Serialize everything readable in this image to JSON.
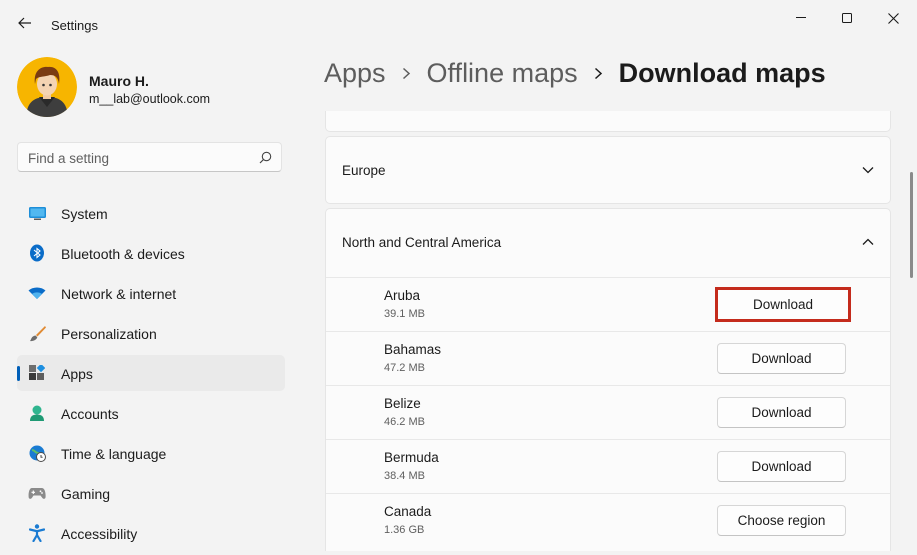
{
  "window": {
    "title": "Settings",
    "back_icon": "back-arrow-icon",
    "controls": [
      "minimize-icon",
      "maximize-icon",
      "close-icon"
    ]
  },
  "profile": {
    "name": "Mauro H.",
    "email": "m__lab@outlook.com"
  },
  "search": {
    "placeholder": "Find a setting",
    "icon": "search-icon"
  },
  "sidebar": {
    "items": [
      {
        "label": "System",
        "icon": "system-icon",
        "active": false
      },
      {
        "label": "Bluetooth & devices",
        "icon": "bluetooth-icon",
        "active": false
      },
      {
        "label": "Network & internet",
        "icon": "wifi-icon",
        "active": false
      },
      {
        "label": "Personalization",
        "icon": "brush-icon",
        "active": false
      },
      {
        "label": "Apps",
        "icon": "apps-icon",
        "active": true
      },
      {
        "label": "Accounts",
        "icon": "accounts-icon",
        "active": false
      },
      {
        "label": "Time & language",
        "icon": "globe-clock-icon",
        "active": false
      },
      {
        "label": "Gaming",
        "icon": "gamepad-icon",
        "active": false
      },
      {
        "label": "Accessibility",
        "icon": "accessibility-icon",
        "active": false
      }
    ]
  },
  "breadcrumb": {
    "items": [
      "Apps",
      "Offline maps",
      "Download maps"
    ]
  },
  "regions": {
    "europe": {
      "label": "Europe",
      "expanded": false
    },
    "north_central_america": {
      "label": "North and Central America",
      "expanded": true,
      "countries": [
        {
          "name": "Aruba",
          "size": "39.1 MB",
          "action": "Download",
          "highlighted": true
        },
        {
          "name": "Bahamas",
          "size": "47.2 MB",
          "action": "Download",
          "highlighted": false
        },
        {
          "name": "Belize",
          "size": "46.2 MB",
          "action": "Download",
          "highlighted": false
        },
        {
          "name": "Bermuda",
          "size": "38.4 MB",
          "action": "Download",
          "highlighted": false
        },
        {
          "name": "Canada",
          "size": "1.36 GB",
          "action": "Choose region",
          "highlighted": false
        }
      ]
    }
  },
  "colors": {
    "accent": "#005fb8",
    "highlight_border": "#c42b1c",
    "window_bg": "#f3f3f3",
    "card_bg": "#fbfbfb"
  }
}
